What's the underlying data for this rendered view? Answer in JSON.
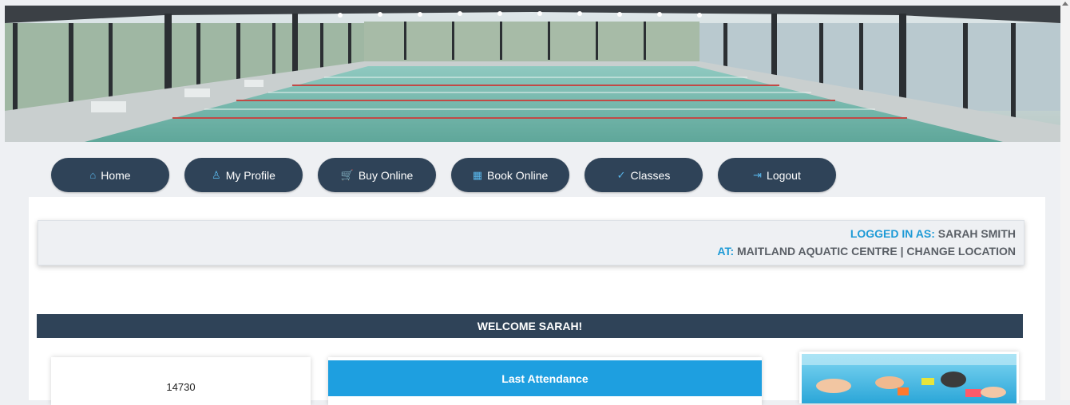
{
  "banner": {
    "image": "indoor-pool-photo"
  },
  "nav": [
    {
      "label": "Home",
      "icon": "home-icon",
      "glyph": "⌂"
    },
    {
      "label": "My Profile",
      "icon": "user-icon",
      "glyph": "♙"
    },
    {
      "label": "Buy Online",
      "icon": "cart-icon",
      "glyph": "🛒"
    },
    {
      "label": "Book Online",
      "icon": "calendar-icon",
      "glyph": "▦"
    },
    {
      "label": "Classes",
      "icon": "swimmer-icon",
      "glyph": "✓"
    },
    {
      "label": "Logout",
      "icon": "logout-icon",
      "glyph": "⇥"
    }
  ],
  "login": {
    "logged_in_label": "LOGGED IN AS:",
    "user_name": "SARAH SMITH",
    "at_label": "AT:",
    "location": "MAITLAND AQUATIC CENTRE",
    "separator": "|",
    "change_location": "CHANGE LOCATION"
  },
  "welcome": "WELCOME SARAH!",
  "member": {
    "number": "14730"
  },
  "attendance": {
    "title": "Last Attendance"
  },
  "promo": {
    "image": "kids-swimming-photo"
  },
  "colors": {
    "nav_bg": "#2f4358",
    "accent_blue": "#1d9ad6",
    "attendance_header": "#1e9fe0",
    "page_bg": "#eef0f3"
  }
}
